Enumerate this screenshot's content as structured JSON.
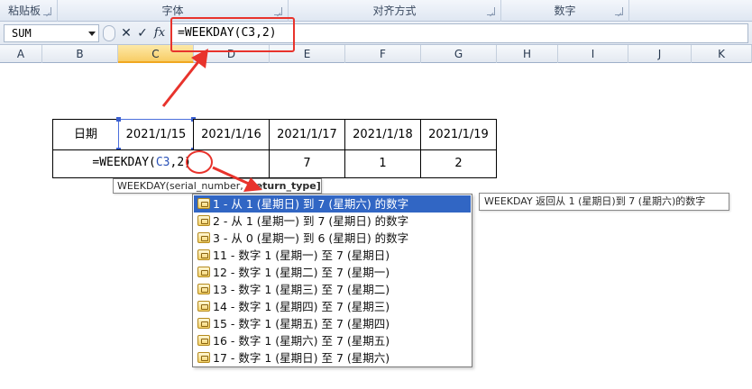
{
  "ribbon": {
    "groups": [
      {
        "label": "粘贴板"
      },
      {
        "label": "字体"
      },
      {
        "label": "对齐方式"
      },
      {
        "label": "数字"
      }
    ]
  },
  "formula_bar": {
    "name_box": "SUM",
    "cancel_icon": "✕",
    "enter_icon": "✓",
    "fx_label": "fx",
    "formula": "=WEEKDAY(C3,2)"
  },
  "columns": [
    "A",
    "B",
    "C",
    "D",
    "E",
    "F",
    "G",
    "H",
    "I",
    "J",
    "K"
  ],
  "active_column": "C",
  "table": {
    "header_label": "日期",
    "dates": [
      "2021/1/15",
      "2021/1/16",
      "2021/1/17",
      "2021/1/18",
      "2021/1/19"
    ],
    "formula_prefix": "=WEEKDAY(",
    "formula_ref": "C3",
    "formula_suffix": ",2)",
    "results": [
      "7",
      "1",
      "2"
    ]
  },
  "tooltip": {
    "function_prefix": "WEEKDAY(serial_number, ",
    "bold_arg": "[return_type]",
    "suffix": ")"
  },
  "dropdown": {
    "items": [
      "1 - 从 1 (星期日) 到 7 (星期六) 的数字",
      "2 - 从 1 (星期一) 到 7 (星期日) 的数字",
      "3 - 从 0 (星期一) 到 6 (星期日) 的数字",
      "11 - 数字 1 (星期一) 至 7 (星期日)",
      "12 - 数字 1 (星期二) 至 7 (星期一)",
      "13 - 数字 1 (星期三) 至 7 (星期二)",
      "14 - 数字 1 (星期四) 至 7 (星期三)",
      "15 - 数字 1 (星期五) 至 7 (星期四)",
      "16 - 数字 1 (星期六) 至 7 (星期五)",
      "17 - 数字 1 (星期日) 至 7 (星期六)"
    ],
    "selected_index": 0
  },
  "side_tooltip": "WEEKDAY 返回从 1 (星期日)到 7 (星期六)的数字",
  "colors": {
    "annotation_red": "#e8332c",
    "selection_blue": "#3166c4",
    "reference_blue": "#2a52b8"
  }
}
